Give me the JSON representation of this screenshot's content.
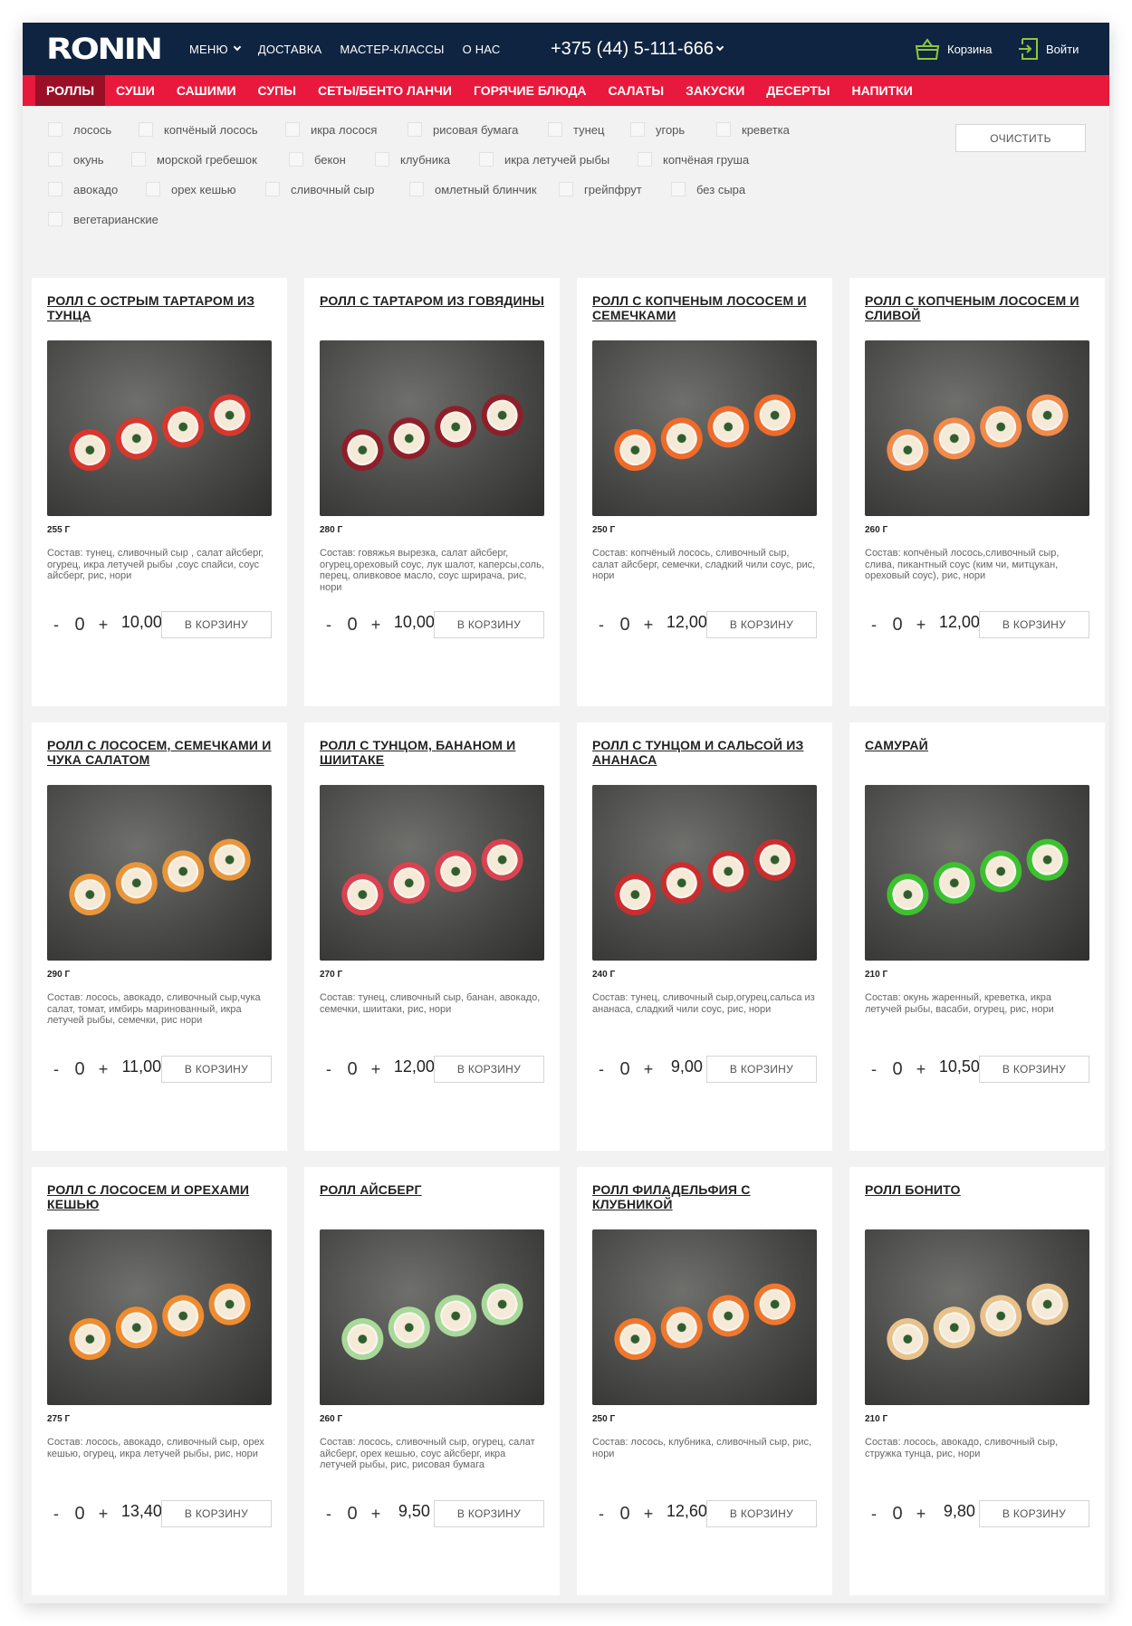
{
  "header": {
    "logo": "RONIN",
    "nav": [
      {
        "label": "МЕНЮ",
        "dropdown": true
      },
      {
        "label": "ДОСТАВКА",
        "dropdown": false
      },
      {
        "label": "МАСТЕР-КЛАССЫ",
        "dropdown": false
      },
      {
        "label": "О НАС",
        "dropdown": false
      }
    ],
    "phone": "+375 (44) 5-111-666",
    "cart_label": "Корзина",
    "login_label": "Войти",
    "accent_color": "#8dc63f"
  },
  "categories": [
    {
      "label": "РОЛЛЫ",
      "active": true
    },
    {
      "label": "СУШИ",
      "active": false
    },
    {
      "label": "САШИМИ",
      "active": false
    },
    {
      "label": "СУПЫ",
      "active": false
    },
    {
      "label": "СЕТЫ/БЕНТО ЛАНЧИ",
      "active": false
    },
    {
      "label": "ГОРЯЧИЕ БЛЮДА",
      "active": false
    },
    {
      "label": "САЛАТЫ",
      "active": false
    },
    {
      "label": "ЗАКУСКИ",
      "active": false
    },
    {
      "label": "ДЕСЕРТЫ",
      "active": false
    },
    {
      "label": "НАПИТКИ",
      "active": false
    }
  ],
  "filters": {
    "rows": [
      [
        "лосось",
        "копчёный лосось",
        "икра лосося",
        "рисовая бумага",
        "тунец",
        "угорь",
        "креветка"
      ],
      [
        "окунь",
        "морской гребешок",
        "бекон",
        "клубника",
        "икра летучей рыбы",
        "копчёная груша"
      ],
      [
        "авокадо",
        "орех кешью",
        "сливочный сыр",
        "омлетный блинчик",
        "грейпфрут",
        "без сыра"
      ],
      [
        "вегетарианские"
      ]
    ],
    "clear_label": "ОЧИСТИТЬ"
  },
  "add_to_cart_label": "В КОРЗИНУ",
  "products": [
    {
      "title": "РОЛЛ С ОСТРЫМ ТАРТАРОМ ИЗ ТУНЦА",
      "weight": "255 Г",
      "desc": "Состав: тунец, сливочный сыр , салат айсберг, огурец, икра летучей рыбы ,соус спайси, соус айсберг, рис, нори",
      "price": "10,00 руб.",
      "qty": "0",
      "roll_color": "#d8372e"
    },
    {
      "title": "РОЛЛ С ТАРТАРОМ ИЗ ГОВЯДИНЫ",
      "weight": "280 Г",
      "desc": "Состав: говяжья вырезка, салат айсберг, огурец,ореховый соус, лук шалот, каперсы,соль, перец, оливковое масло, соус шрирача, рис, нори",
      "price": "10,00 руб.",
      "qty": "0",
      "roll_color": "#8e1f2a"
    },
    {
      "title": "РОЛЛ С КОПЧЕНЫМ ЛОСОСЕМ И СЕМЕЧКАМИ",
      "weight": "250 Г",
      "desc": "Состав: копчёный лосось, сливочный сыр, салат айсберг, семечки, сладкий чили соус, рис, нори",
      "price": "12,00 руб.",
      "qty": "0",
      "roll_color": "#f06a2a"
    },
    {
      "title": "РОЛЛ С КОПЧЕНЫМ ЛОСОСЕМ И СЛИВОЙ",
      "weight": "260 Г",
      "desc": "Состав: копчёный лосось,сливочный сыр, слива, пикантный соус (ким чи, митцукан, ореховый соус), рис, нори",
      "price": "12,00 руб.",
      "qty": "0",
      "roll_color": "#f28a4a"
    },
    {
      "title": "РОЛЛ С ЛОСОСЕМ, СЕМЕЧКАМИ И ЧУКА САЛАТОМ",
      "weight": "290 Г",
      "desc": "Состав: лосось, авокадо, сливочный сыр,чука салат, томат, имбирь маринованный, икра летучей рыбы, семечки, рис нори",
      "price": "11,00 руб.",
      "qty": "0",
      "roll_color": "#e9963a"
    },
    {
      "title": "РОЛЛ С ТУНЦОМ, БАНАНОМ И ШИИТАКЕ",
      "weight": "270 Г",
      "desc": "Состав: тунец, сливочный сыр, банан, авокадо, семечки, шиитаки, рис, нори",
      "price": "12,00 руб.",
      "qty": "0",
      "roll_color": "#d9434f"
    },
    {
      "title": "РОЛЛ С ТУНЦОМ И САЛЬСОЙ ИЗ АНАНАСА",
      "weight": "240 Г",
      "desc": "Состав: тунец, сливочный сыр,огурец,сальса из ананаса, сладкий чили соус, рис, нори",
      "price": "9,00 руб.",
      "qty": "0",
      "roll_color": "#c92d2d"
    },
    {
      "title": "САМУРАЙ",
      "weight": "210 Г",
      "desc": "Состав: окунь жаренный, креветка, икра летучей рыбы, васаби, огурец, рис, нори",
      "price": "10,50 руб.",
      "qty": "0",
      "roll_color": "#3dc22f"
    },
    {
      "title": "РОЛЛ С ЛОСОСЕМ И ОРЕХАМИ КЕШЬЮ",
      "weight": "275 Г",
      "desc": "Состав: лосось, авокадо, сливочный сыр, орех кешью, огурец, икра летучей рыбы, рис, нори",
      "price": "13,40 руб.",
      "qty": "0",
      "roll_color": "#f08c2e"
    },
    {
      "title": "РОЛЛ АЙСБЕРГ",
      "weight": "260 Г",
      "desc": "Состав: лосось, сливочный сыр, огурец, салат айсберг, орех кешью, соус айсберг, икра летучей рыбы, рис, рисовая бумага",
      "price": "9,50 руб.",
      "qty": "0",
      "roll_color": "#a8d99a"
    },
    {
      "title": "РОЛЛ ФИЛАДЕЛЬФИЯ С КЛУБНИКОЙ",
      "weight": "250 Г",
      "desc": "Состав: лосось, клубника, сливочный сыр, рис, нори",
      "price": "12,60 руб.",
      "qty": "0",
      "roll_color": "#f0782e"
    },
    {
      "title": "РОЛЛ БОНИТО",
      "weight": "210 Г",
      "desc": "Состав: лосось, авокадо, сливочный сыр, стружка тунца, рис, нори",
      "price": "9,80 руб.",
      "qty": "0",
      "roll_color": "#e8c28a"
    }
  ]
}
